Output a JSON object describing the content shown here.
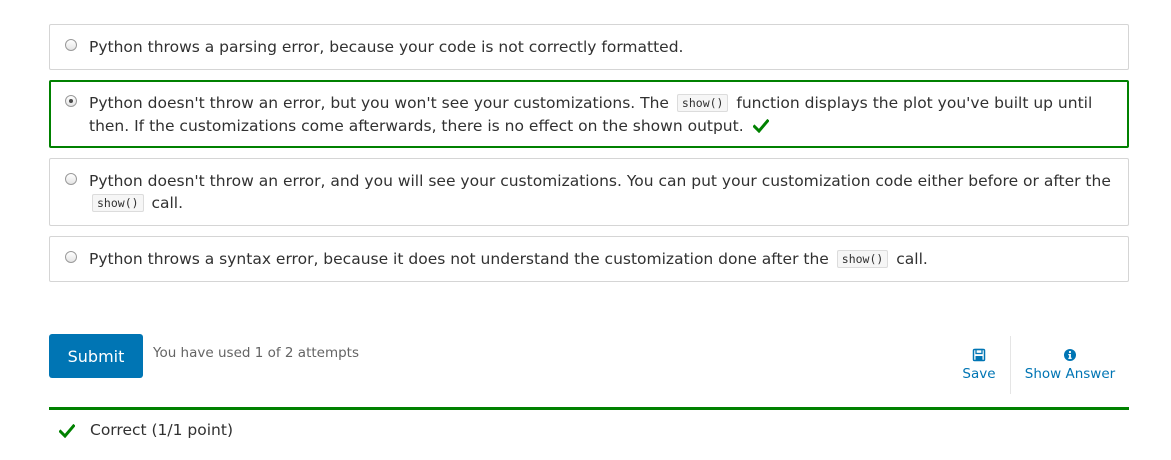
{
  "choices": [
    {
      "parts": [
        "Python throws a parsing error, because your code is not correctly formatted."
      ],
      "selected": false,
      "correct": false
    },
    {
      "parts": [
        "Python doesn't throw an error, but you won't see your customizations. The",
        "show()",
        "function displays the plot you've built up until then. If the customizations come afterwards, there is no effect on the shown output."
      ],
      "selected": true,
      "correct": true
    },
    {
      "parts": [
        "Python doesn't throw an error, and you will see your customizations. You can put your customization code either before or after the",
        "show()",
        "call."
      ],
      "selected": false,
      "correct": false
    },
    {
      "parts": [
        "Python throws a syntax error, because it does not understand the customization done after the",
        "show()",
        "call."
      ],
      "selected": false,
      "correct": false
    }
  ],
  "submit": {
    "label": "Submit"
  },
  "attempts": {
    "text": "You have used 1 of 2 attempts"
  },
  "actions": {
    "save": {
      "label": "Save",
      "icon": "floppy-disk-icon"
    },
    "show_answer": {
      "label": "Show Answer",
      "icon": "info-circle-icon"
    }
  },
  "feedback": {
    "text": "Correct (1/1 point)",
    "icon": "checkmark-icon"
  },
  "colors": {
    "correct": "#008100",
    "accent": "#0075b4",
    "border": "#d5d5d5",
    "text": "#313131",
    "muted": "#646464"
  }
}
